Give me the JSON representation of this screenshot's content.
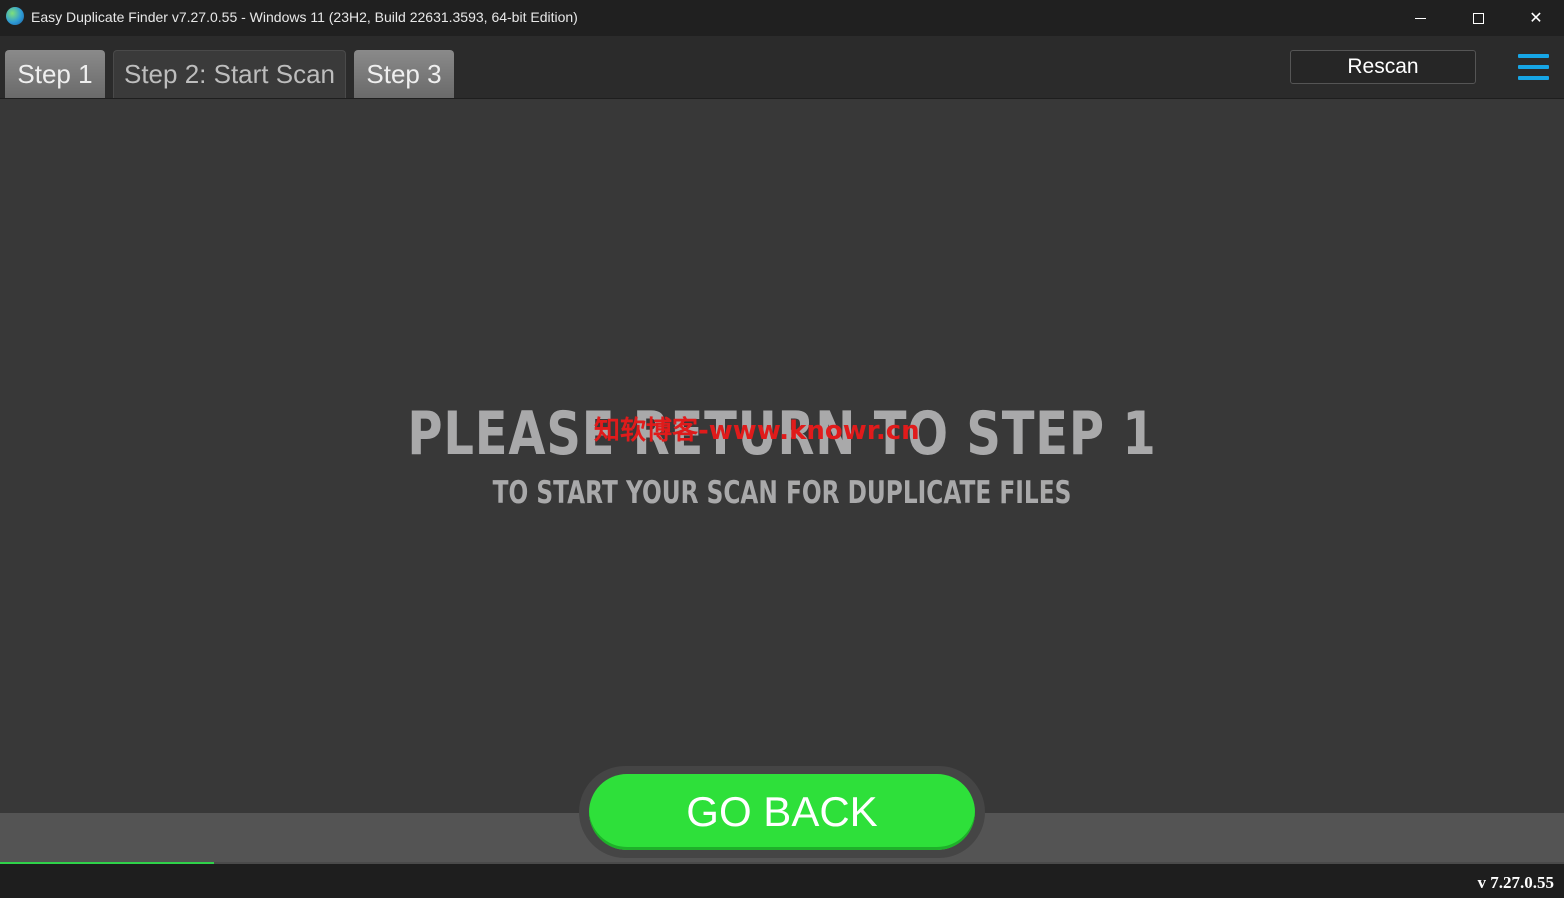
{
  "window": {
    "title": "Easy Duplicate Finder v7.27.0.55 - Windows 11 (23H2, Build 22631.3593, 64-bit Edition)",
    "icon": "globe-app-icon"
  },
  "tabs": [
    {
      "label": "Step 1",
      "state": "inactive"
    },
    {
      "label": "Step 2: Start Scan",
      "state": "active"
    },
    {
      "label": "Step 3",
      "state": "inactive"
    }
  ],
  "toolbar": {
    "rescan_label": "Rescan",
    "menu_icon": "hamburger-menu-icon"
  },
  "main": {
    "headline": "PLEASE RETURN TO STEP 1",
    "subline": "TO START YOUR SCAN FOR DUPLICATE FILES",
    "watermark": "知软博客-www.knowr.cn"
  },
  "actions": {
    "go_back_label": "GO BACK"
  },
  "progress": {
    "fraction": 0.137
  },
  "status": {
    "version": "v 7.27.0.55"
  },
  "colors": {
    "accent_green": "#2ee03a",
    "menu_blue": "#16a6e6",
    "watermark_red": "#e01b1b"
  }
}
